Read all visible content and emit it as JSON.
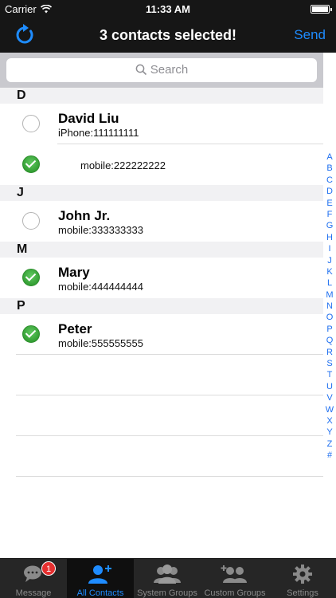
{
  "status": {
    "carrier": "Carrier",
    "time": "11:33 AM"
  },
  "nav": {
    "title": "3 contacts selected!",
    "send": "Send"
  },
  "search": {
    "placeholder": "Search"
  },
  "sections": [
    {
      "letter": "D"
    },
    {
      "letter": "J"
    },
    {
      "letter": "M"
    },
    {
      "letter": "P"
    }
  ],
  "contacts": [
    {
      "name": "David Liu",
      "phone": "iPhone:111111111",
      "selected": false
    },
    {
      "phone": "mobile:222222222",
      "selected": true
    },
    {
      "name": "John Jr.",
      "phone": "mobile:333333333",
      "selected": false
    },
    {
      "name": "Mary",
      "phone": "mobile:444444444",
      "selected": true
    },
    {
      "name": "Peter",
      "phone": "mobile:555555555",
      "selected": true
    }
  ],
  "index": [
    "A",
    "B",
    "C",
    "D",
    "E",
    "F",
    "G",
    "H",
    "I",
    "J",
    "K",
    "L",
    "M",
    "N",
    "O",
    "P",
    "Q",
    "R",
    "S",
    "T",
    "U",
    "V",
    "W",
    "X",
    "Y",
    "Z",
    "#"
  ],
  "tabs": [
    {
      "label": "Message",
      "icon": "message-icon",
      "badge": "1"
    },
    {
      "label": "All Contacts",
      "icon": "add-contact-icon",
      "active": true
    },
    {
      "label": "System Groups",
      "icon": "group-icon"
    },
    {
      "label": "Custom Groups",
      "icon": "add-group-icon"
    },
    {
      "label": "Settings",
      "icon": "gear-icon"
    }
  ],
  "colors": {
    "accent": "#1e8cff",
    "selected": "#2e9a2e",
    "badge": "#e53030"
  }
}
